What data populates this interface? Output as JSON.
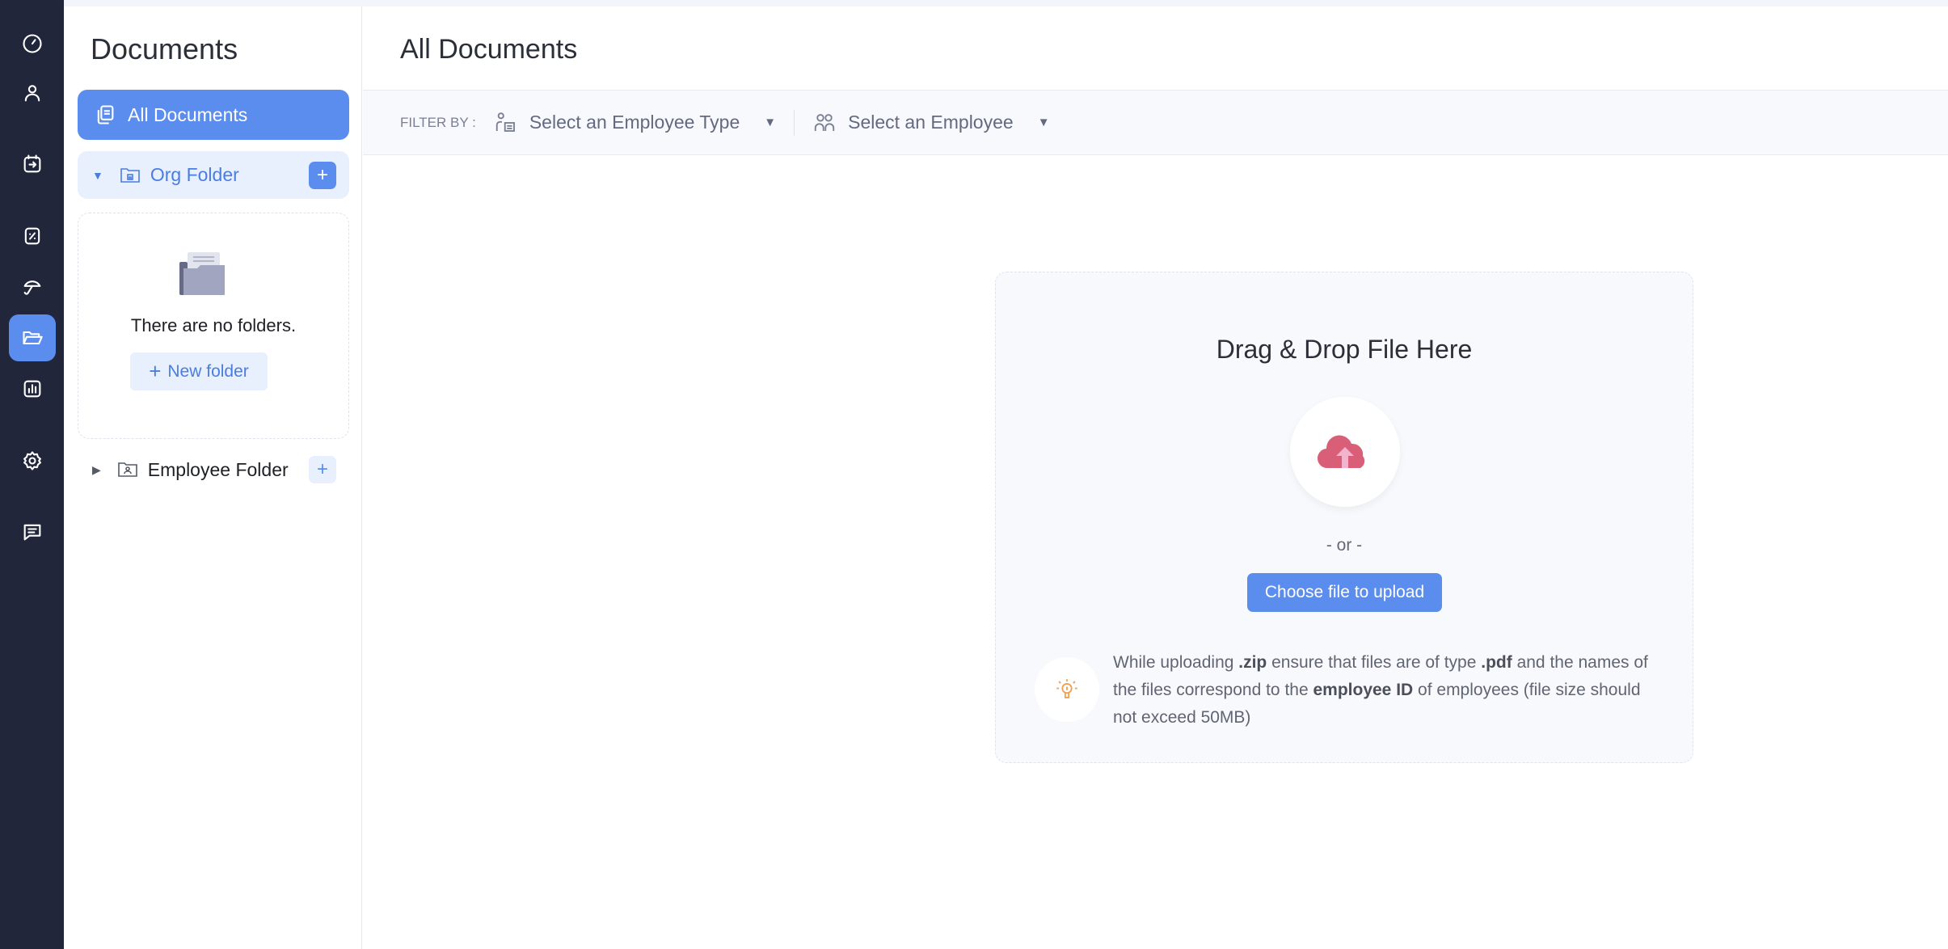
{
  "nav": {
    "items": [
      {
        "name": "dashboard"
      },
      {
        "name": "people"
      },
      {
        "name": "attendance"
      },
      {
        "name": "payroll"
      },
      {
        "name": "leave"
      },
      {
        "name": "documents",
        "active": true
      },
      {
        "name": "reports"
      },
      {
        "name": "settings"
      },
      {
        "name": "messages"
      }
    ]
  },
  "panel": {
    "title": "Documents",
    "all_documents": "All Documents",
    "org_folder": "Org Folder",
    "empty_text": "There are no folders.",
    "new_folder": "New folder",
    "employee_folder": "Employee Folder",
    "plus": "+"
  },
  "main": {
    "title": "All Documents",
    "filter_label": "FILTER BY :",
    "employee_type_placeholder": "Select an Employee Type",
    "employee_placeholder": "Select an Employee"
  },
  "upload": {
    "title": "Drag & Drop File Here",
    "or": "- or -",
    "choose": "Choose file to upload",
    "info_parts": [
      "While uploading ",
      ".zip",
      " ensure that files are of type ",
      ".pdf",
      " and the names of the files correspond to the ",
      "employee ID",
      " of employees (file size should not exceed 50MB)"
    ]
  },
  "colors": {
    "accent": "#5b8def",
    "nav_bg": "#21263a",
    "upload_icon": "#d95f78"
  }
}
